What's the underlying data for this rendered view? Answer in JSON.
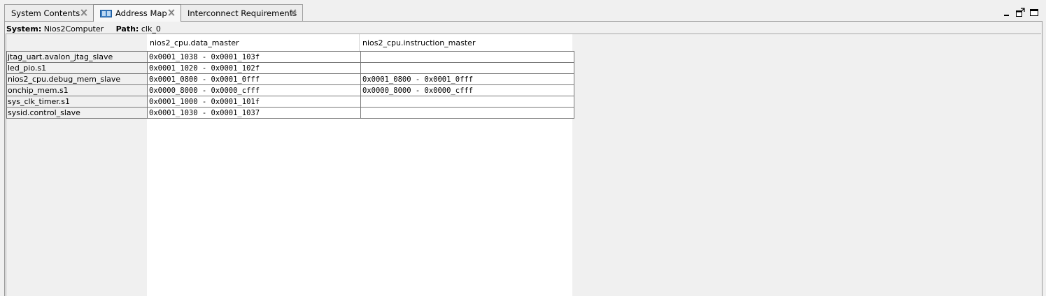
{
  "tabs": [
    {
      "label": "System Contents",
      "active": false,
      "icon": null
    },
    {
      "label": "Address Map",
      "active": true,
      "icon": "address-map-icon"
    },
    {
      "label": "Interconnect Requirements",
      "active": false,
      "icon": null
    }
  ],
  "window_controls": [
    "minimize-icon",
    "restore-icon",
    "maximize-icon"
  ],
  "path_bar": {
    "system_label": "System:",
    "system_value": "Nios2Computer",
    "path_label": "Path:",
    "path_value": "clk_0"
  },
  "columns": [
    "nios2_cpu.data_master",
    "nios2_cpu.instruction_master"
  ],
  "rows": [
    {
      "slave": "jtag_uart.avalon_jtag_slave",
      "data_master": "0x0001_1038 - 0x0001_103f",
      "instruction_master": ""
    },
    {
      "slave": "led_pio.s1",
      "data_master": "0x0001_1020 - 0x0001_102f",
      "instruction_master": ""
    },
    {
      "slave": "nios2_cpu.debug_mem_slave",
      "data_master": "0x0001_0800 - 0x0001_0fff",
      "instruction_master": "0x0001_0800 - 0x0001_0fff"
    },
    {
      "slave": "onchip_mem.s1",
      "data_master": "0x0000_8000 - 0x0000_cfff",
      "instruction_master": "0x0000_8000 - 0x0000_cfff"
    },
    {
      "slave": "sys_clk_timer.s1",
      "data_master": "0x0001_1000 - 0x0001_101f",
      "instruction_master": ""
    },
    {
      "slave": "sysid.control_slave",
      "data_master": "0x0001_1030 - 0x0001_1037",
      "instruction_master": ""
    }
  ]
}
